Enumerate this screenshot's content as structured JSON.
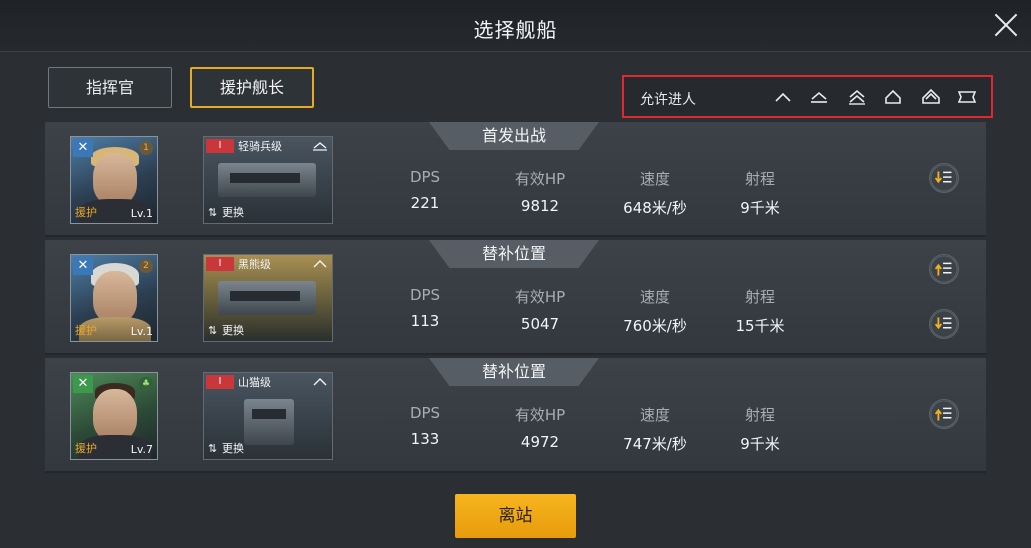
{
  "header": {
    "title": "选择舰船"
  },
  "tabs": [
    {
      "label": "指挥官"
    },
    {
      "label": "援护舰长"
    }
  ],
  "filter": {
    "label": "允许进人",
    "icons": [
      "frigate-icon",
      "destroyer-icon",
      "cruiser-icon",
      "battlecruiser-icon",
      "battleship-icon",
      "carrier-icon"
    ]
  },
  "rows": [
    {
      "tag": "首发出战",
      "captain": {
        "role": "援护",
        "level": "Lv.1",
        "rank": "1",
        "skill_icon": "wrench-icon"
      },
      "ship": {
        "tier": "I",
        "name": "轻骑兵级",
        "swap_label": "更换"
      },
      "stats": {
        "dps_label": "DPS",
        "dps": "221",
        "hp_label": "有效HP",
        "hp": "9812",
        "speed_label": "速度",
        "speed": "648米/秒",
        "range_label": "射程",
        "range": "9千米"
      }
    },
    {
      "tag": "替补位置",
      "captain": {
        "role": "援护",
        "level": "Lv.1",
        "rank": "2",
        "skill_icon": "wrench-icon"
      },
      "ship": {
        "tier": "I",
        "name": "黑熊级",
        "swap_label": "更换"
      },
      "stats": {
        "dps_label": "DPS",
        "dps": "113",
        "hp_label": "有效HP",
        "hp": "5047",
        "speed_label": "速度",
        "speed": "760米/秒",
        "range_label": "射程",
        "range": "15千米"
      }
    },
    {
      "tag": "替补位置",
      "captain": {
        "role": "援护",
        "level": "Lv.7",
        "rank": "",
        "skill_icon": "wrench-icon"
      },
      "ship": {
        "tier": "I",
        "name": "山猫级",
        "swap_label": "更换"
      },
      "stats": {
        "dps_label": "DPS",
        "dps": "133",
        "hp_label": "有效HP",
        "hp": "4972",
        "speed_label": "速度",
        "speed": "747米/秒",
        "range_label": "射程",
        "range": "9千米"
      }
    }
  ],
  "depart_label": "离站",
  "colors": {
    "accent": "#e7a928",
    "button": "#f2a816",
    "highlight_border": "#e02830",
    "tier_badge": "#c9373a"
  }
}
